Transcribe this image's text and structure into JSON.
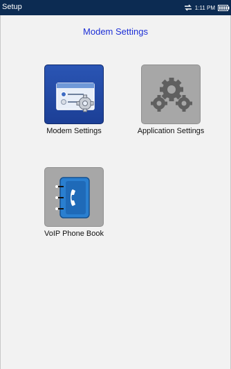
{
  "status_bar": {
    "title": "Setup",
    "time": "1:11 PM",
    "icons": [
      "sync-icon",
      "battery-icon"
    ]
  },
  "page": {
    "title": "Modem Settings"
  },
  "tiles": [
    {
      "label": "Modem Settings",
      "icon": "modem-settings-icon"
    },
    {
      "label": "Application Settings",
      "icon": "gears-icon"
    },
    {
      "label": "VoIP Phone Book",
      "icon": "phone-book-icon"
    }
  ],
  "colors": {
    "status_bar_bg": "#0c2b52",
    "title_text": "#1d2fd6",
    "background": "#f2f2f2",
    "tile_active": "#1c3f96",
    "tile_inactive": "#a7a7a7"
  }
}
